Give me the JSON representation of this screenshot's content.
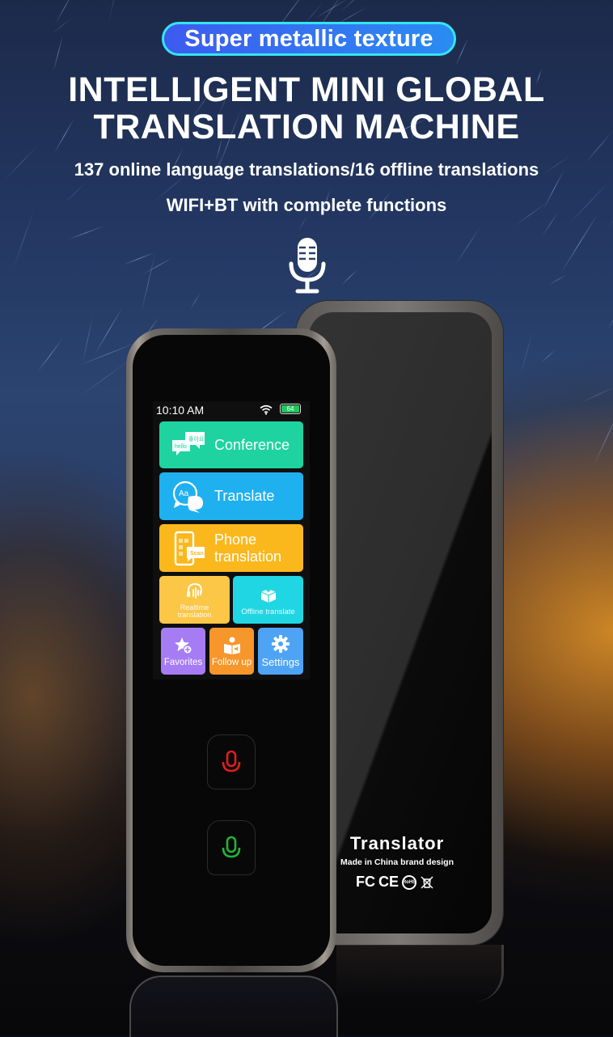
{
  "banner": {
    "pill_label": "Super metallic texture",
    "title_line1": "INTELLIGENT MINI GLOBAL",
    "title_line2": "TRANSLATION MACHINE",
    "subtitle1": "137 online language translations/16 offline translations",
    "subtitle2": "WIFI+BT with complete functions",
    "top_icon": "microphone-icon"
  },
  "device_screen": {
    "status_bar": {
      "time": "10:10 AM",
      "wifi_icon": "wifi-icon",
      "battery_level": "64",
      "battery_color": "#22c55e"
    },
    "tiles": [
      {
        "label": "Conference",
        "icon": "chat-bubbles-icon",
        "color": "#1ed3a0"
      },
      {
        "label": "Translate",
        "icon": "aa-bubble-icon",
        "color": "#1fb0f0"
      },
      {
        "label_line1": "Phone",
        "label_line2": "translation",
        "icon": "phone-scan-icon",
        "color": "#fbb81c"
      },
      {
        "label_line1": "Realtime",
        "label_line2": "translation",
        "icon": "headset-wave-icon",
        "color": "#fcc646"
      },
      {
        "label": "Offline translate",
        "icon": "box-download-icon",
        "color": "#21d6e3"
      },
      {
        "label": "Favorites",
        "icon": "star-plus-icon",
        "color": "#a67cf4"
      },
      {
        "label": "Follow up",
        "icon": "reader-icon",
        "color": "#f7962b"
      },
      {
        "label": "Settings",
        "icon": "gear-icon",
        "color": "#4fa3f5"
      }
    ],
    "hardware_buttons": [
      {
        "name": "mic-button-red",
        "color": "#e11d1d"
      },
      {
        "name": "mic-button-green",
        "color": "#22b33a"
      }
    ]
  },
  "back_device": {
    "title": "Translator",
    "made_in": "Made in China brand design",
    "certifications": [
      "FC",
      "CE",
      "RoHS",
      "WEEE"
    ]
  }
}
